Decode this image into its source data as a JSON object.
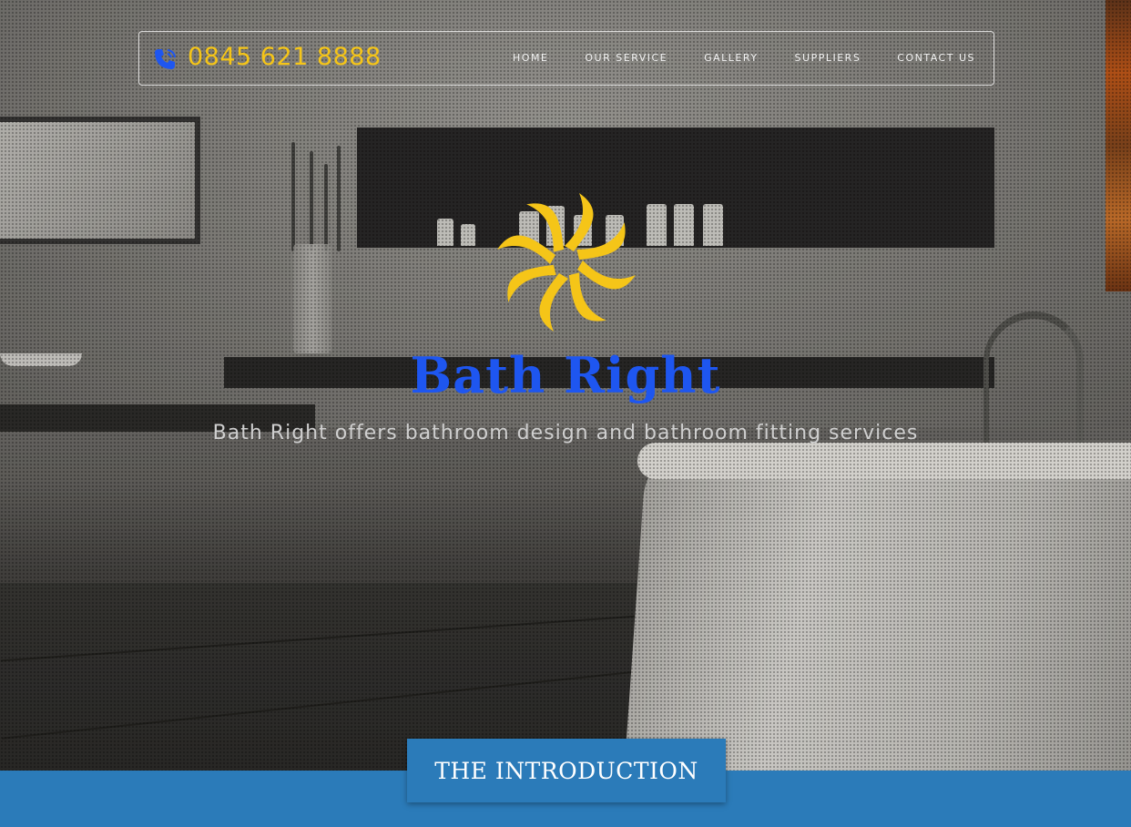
{
  "header": {
    "phone": "0845 621 8888",
    "nav": [
      "HOME",
      "OUR SERVICE",
      "GALLERY",
      "SUPPLIERS",
      "CONTACT US"
    ]
  },
  "hero": {
    "logo_icon": "sun-swirl-logo-icon",
    "title": "Bath Right",
    "tagline": "Bath Right offers bathroom design and bathroom fitting services"
  },
  "intro": {
    "button_label": "THE INTRODUCTION"
  },
  "colors": {
    "accent_gold": "#f5c518",
    "brand_blue": "#1e56f0",
    "band_blue": "#2b7bb9"
  }
}
